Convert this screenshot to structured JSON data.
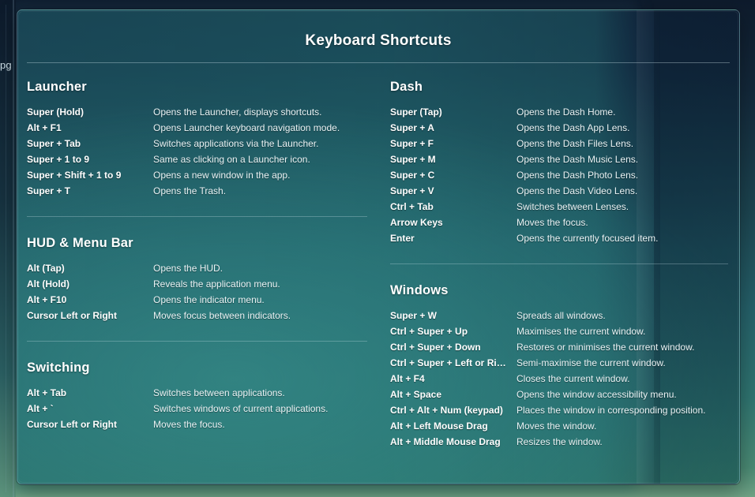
{
  "background": {
    "edge_text": "pg"
  },
  "overlay": {
    "title": "Keyboard Shortcuts",
    "accent_color": "#2b6f72",
    "title_color": "#ffffff",
    "columns": [
      {
        "id": "left",
        "sections": [
          {
            "title": "Launcher",
            "rows": [
              {
                "key": "Super (Hold)",
                "desc": "Opens the Launcher, displays shortcuts."
              },
              {
                "key": "Alt + F1",
                "desc": "Opens Launcher keyboard navigation mode."
              },
              {
                "key": "Super + Tab",
                "desc": "Switches applications via the Launcher."
              },
              {
                "key": "Super + 1 to 9",
                "desc": "Same as clicking on a Launcher icon."
              },
              {
                "key": "Super + Shift + 1 to 9",
                "desc": "Opens a new window in the app."
              },
              {
                "key": "Super + T",
                "desc": "Opens the Trash."
              }
            ]
          },
          {
            "title": "HUD & Menu Bar",
            "rows": [
              {
                "key": "Alt (Tap)",
                "desc": "Opens the HUD."
              },
              {
                "key": "Alt (Hold)",
                "desc": "Reveals the application menu."
              },
              {
                "key": "Alt + F10",
                "desc": "Opens the indicator menu."
              },
              {
                "key": "Cursor Left or Right",
                "desc": "Moves focus between indicators."
              }
            ]
          },
          {
            "title": "Switching",
            "rows": [
              {
                "key": "Alt + Tab",
                "desc": "Switches between applications."
              },
              {
                "key": "Alt + `",
                "desc": "Switches windows of current applications."
              },
              {
                "key": "Cursor Left or Right",
                "desc": "Moves the focus."
              }
            ]
          }
        ]
      },
      {
        "id": "right",
        "sections": [
          {
            "title": "Dash",
            "rows": [
              {
                "key": "Super (Tap)",
                "desc": "Opens the Dash Home."
              },
              {
                "key": "Super + A",
                "desc": "Opens the Dash App Lens."
              },
              {
                "key": "Super + F",
                "desc": "Opens the Dash Files Lens."
              },
              {
                "key": "Super + M",
                "desc": "Opens the Dash Music Lens."
              },
              {
                "key": "Super + C",
                "desc": "Opens the Dash Photo Lens."
              },
              {
                "key": "Super + V",
                "desc": "Opens the Dash Video Lens."
              },
              {
                "key": "Ctrl + Tab",
                "desc": "Switches between Lenses."
              },
              {
                "key": "Arrow Keys",
                "desc": "Moves the focus."
              },
              {
                "key": "Enter",
                "desc": "Opens the currently focused item."
              }
            ]
          },
          {
            "title": "Windows",
            "rows": [
              {
                "key": "Super + W",
                "desc": "Spreads all windows."
              },
              {
                "key": "Ctrl + Super + Up",
                "desc": "Maximises the current window."
              },
              {
                "key": "Ctrl + Super + Down",
                "desc": "Restores or minimises the current window."
              },
              {
                "key": "Ctrl + Super + Left or Ri…",
                "desc": "Semi-maximise the current window."
              },
              {
                "key": "Alt + F4",
                "desc": "Closes the current window."
              },
              {
                "key": "Alt + Space",
                "desc": "Opens the window accessibility menu."
              },
              {
                "key": "Ctrl + Alt + Num (keypad)",
                "desc": "Places the window in corresponding position."
              },
              {
                "key": "Alt + Left Mouse Drag",
                "desc": "Moves the window."
              },
              {
                "key": "Alt + Middle Mouse Drag",
                "desc": "Resizes the window."
              }
            ]
          }
        ]
      }
    ]
  }
}
